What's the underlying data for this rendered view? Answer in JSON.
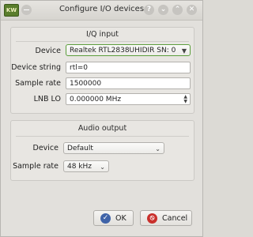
{
  "window": {
    "title": "Configure I/O devices",
    "app_icon_text": "KW"
  },
  "titlebar_buttons": {
    "help": "?",
    "minimize": "⌄",
    "maximize": "⌃",
    "close": "✕"
  },
  "iq_input": {
    "title": "I/Q input",
    "device_label": "Device",
    "device_value": "Realtek RTL2838UHIDIR SN: 0",
    "device_string_label": "Device string",
    "device_string_value": "rtl=0",
    "sample_rate_label": "Sample rate",
    "sample_rate_value": "1500000",
    "lnb_lo_label": "LNB LO",
    "lnb_lo_value": "0.000000 MHz"
  },
  "audio_output": {
    "title": "Audio output",
    "device_label": "Device",
    "device_value": "Default",
    "sample_rate_label": "Sample rate",
    "sample_rate_value": "48 kHz"
  },
  "buttons": {
    "ok": "OK",
    "cancel": "Cancel"
  },
  "colors": {
    "ok_icon": "#3f63a8",
    "cancel_icon": "#c9302c",
    "focus_border": "#5c9e3c"
  }
}
